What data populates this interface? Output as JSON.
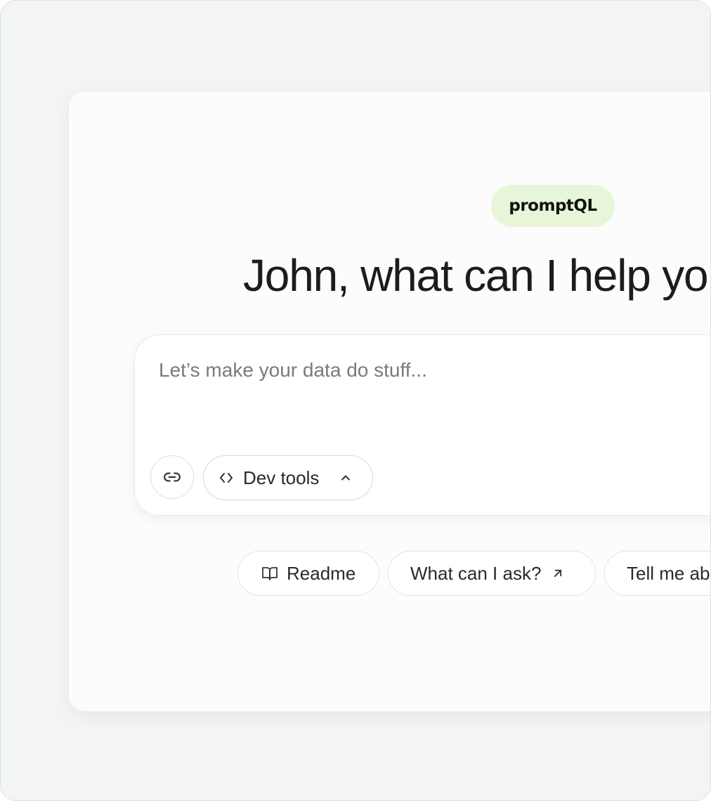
{
  "logo": {
    "text": "promptQL"
  },
  "headline": "John, what can I help you with?",
  "prompt": {
    "placeholder": "Let’s make your data do stuff...",
    "attach_icon": "link-icon",
    "devtools_label": "Dev tools",
    "devtools_icon": "code-brackets-icon",
    "devtools_chevron": "chevron-up-icon"
  },
  "suggestions": [
    {
      "label": "Readme",
      "icon": "book-open-icon"
    },
    {
      "label": "What can I ask?",
      "icon": "arrow-up-right-icon"
    },
    {
      "label": "Tell me about"
    }
  ],
  "colors": {
    "logo_bg": "#e7f6d8",
    "page_bg": "#f2f5f4",
    "card_bg": "#fcfcfc",
    "text": "#1c1c1c"
  }
}
